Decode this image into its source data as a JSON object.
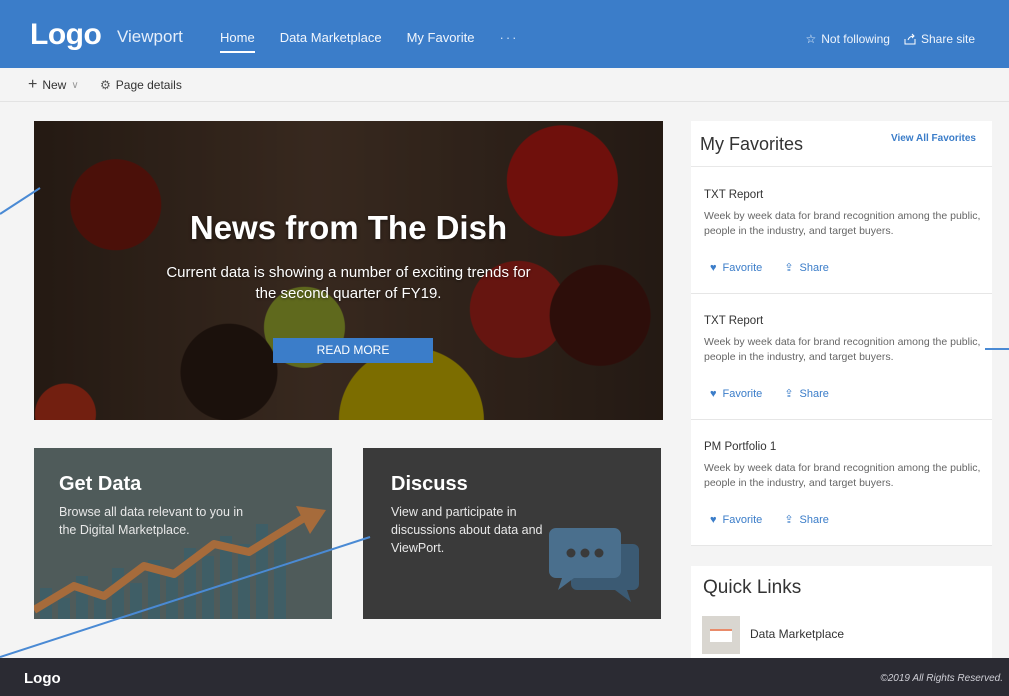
{
  "header": {
    "logo": "Logo",
    "site_name": "Viewport",
    "nav": [
      {
        "label": "Home",
        "active": true
      },
      {
        "label": "Data Marketplace",
        "active": false
      },
      {
        "label": "My Favorite",
        "active": false
      }
    ],
    "more": "···",
    "not_following": "Not following",
    "share_site": "Share site"
  },
  "commandbar": {
    "new_label": "New",
    "page_details_label": "Page details"
  },
  "hero": {
    "title": "News from The Dish",
    "subtitle": "Current data is showing a number of exciting trends for the second quarter of FY19.",
    "button": "READ MORE"
  },
  "tiles": {
    "get_data": {
      "title": "Get Data",
      "text": "Browse all data relevant to you in the Digital Marketplace."
    },
    "discuss": {
      "title": "Discuss",
      "text": "View and participate in discussions about data and ViewPort."
    }
  },
  "favorites": {
    "title": "My Favorites",
    "view_all": "View All Favorites",
    "favorite_label": "Favorite",
    "share_label": "Share",
    "items": [
      {
        "title": "TXT Report",
        "desc": "Week by week data for brand recognition among the public, people in the industry, and target buyers."
      },
      {
        "title": "TXT Report",
        "desc": "Week by week data for brand recognition among the public, people in the industry, and target buyers."
      },
      {
        "title": "PM Portfolio 1",
        "desc": "Week by week data for brand recognition among the public, people in the industry, and target buyers."
      }
    ]
  },
  "quick_links": {
    "title": "Quick Links",
    "items": [
      {
        "label": "Data Marketplace"
      }
    ]
  },
  "footer": {
    "logo": "Logo",
    "copyright": "©2019 All Rights Reserved."
  },
  "colors": {
    "brand_blue": "#3b7dc9",
    "footer_dark": "#2b2b33",
    "callout_line": "#4a8ad4"
  }
}
